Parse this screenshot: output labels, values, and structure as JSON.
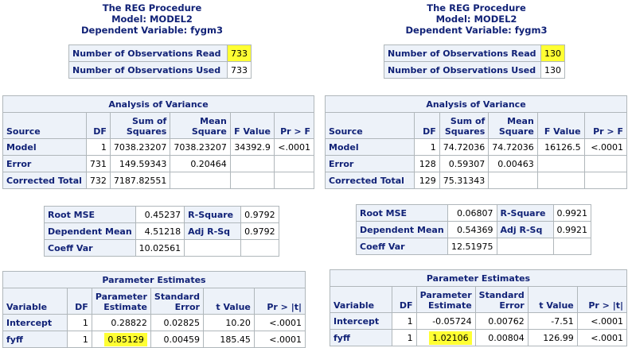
{
  "left": {
    "title": "The REG Procedure",
    "model": "Model: MODEL2",
    "depvar": "Dependent Variable: fygm3",
    "obs": [
      {
        "label": "Number of Observations Read",
        "value": "733"
      },
      {
        "label": "Number of Observations Used",
        "value": "733"
      }
    ],
    "anova": {
      "caption": "Analysis of Variance",
      "headers": {
        "source": "Source",
        "df": "DF",
        "ss": "Sum of Squares",
        "ms": "Mean Square",
        "f": "F Value",
        "p": "Pr > F"
      },
      "rows": [
        {
          "source": "Model",
          "df": "1",
          "ss": "7038.23207",
          "ms": "7038.23207",
          "f": "34392.9",
          "p": "<.0001"
        },
        {
          "source": "Error",
          "df": "731",
          "ss": "149.59343",
          "ms": "0.20464",
          "f": "",
          "p": ""
        },
        {
          "source": "Corrected Total",
          "df": "732",
          "ss": "7187.82551",
          "ms": "",
          "f": "",
          "p": ""
        }
      ]
    },
    "fit": [
      {
        "l1": "Root MSE",
        "v1": "0.45237",
        "l2": "R-Square",
        "v2": "0.9792"
      },
      {
        "l1": "Dependent Mean",
        "v1": "4.51218",
        "l2": "Adj R-Sq",
        "v2": "0.9792"
      },
      {
        "l1": "Coeff Var",
        "v1": "10.02561",
        "l2": "",
        "v2": ""
      }
    ],
    "params": {
      "caption": "Parameter Estimates",
      "headers": {
        "var": "Variable",
        "df": "DF",
        "est": "Parameter Estimate",
        "se": "Standard Error",
        "t": "t Value",
        "p": "Pr > |t|"
      },
      "rows": [
        {
          "var": "Intercept",
          "df": "1",
          "est": "0.28822",
          "se": "0.02825",
          "t": "10.20",
          "p": "<.0001"
        },
        {
          "var": "fyff",
          "df": "1",
          "est": "0.85129",
          "se": "0.00459",
          "t": "185.45",
          "p": "<.0001"
        }
      ]
    }
  },
  "right": {
    "title": "The REG Procedure",
    "model": "Model: MODEL2",
    "depvar": "Dependent Variable: fygm3",
    "obs": [
      {
        "label": "Number of Observations Read",
        "value": "130"
      },
      {
        "label": "Number of Observations Used",
        "value": "130"
      }
    ],
    "anova": {
      "caption": "Analysis of Variance",
      "headers": {
        "source": "Source",
        "df": "DF",
        "ss": "Sum of Squares",
        "ms": "Mean Square",
        "f": "F Value",
        "p": "Pr > F"
      },
      "rows": [
        {
          "source": "Model",
          "df": "1",
          "ss": "74.72036",
          "ms": "74.72036",
          "f": "16126.5",
          "p": "<.0001"
        },
        {
          "source": "Error",
          "df": "128",
          "ss": "0.59307",
          "ms": "0.00463",
          "f": "",
          "p": ""
        },
        {
          "source": "Corrected Total",
          "df": "129",
          "ss": "75.31343",
          "ms": "",
          "f": "",
          "p": ""
        }
      ]
    },
    "fit": [
      {
        "l1": "Root MSE",
        "v1": "0.06807",
        "l2": "R-Square",
        "v2": "0.9921"
      },
      {
        "l1": "Dependent Mean",
        "v1": "0.54369",
        "l2": "Adj R-Sq",
        "v2": "0.9921"
      },
      {
        "l1": "Coeff Var",
        "v1": "12.51975",
        "l2": "",
        "v2": ""
      }
    ],
    "params": {
      "caption": "Parameter Estimates",
      "headers": {
        "var": "Variable",
        "df": "DF",
        "est": "Parameter Estimate",
        "se": "Standard Error",
        "t": "t Value",
        "p": "Pr > |t|"
      },
      "rows": [
        {
          "var": "Intercept",
          "df": "1",
          "est": "-0.05724",
          "se": "0.00762",
          "t": "-7.51",
          "p": "<.0001"
        },
        {
          "var": "fyff",
          "df": "1",
          "est": "1.02106",
          "se": "0.00804",
          "t": "126.99",
          "p": "<.0001"
        }
      ]
    }
  },
  "highlight_color": "#ffff33",
  "header_bg": "#edf2f9",
  "header_text": "#112277"
}
